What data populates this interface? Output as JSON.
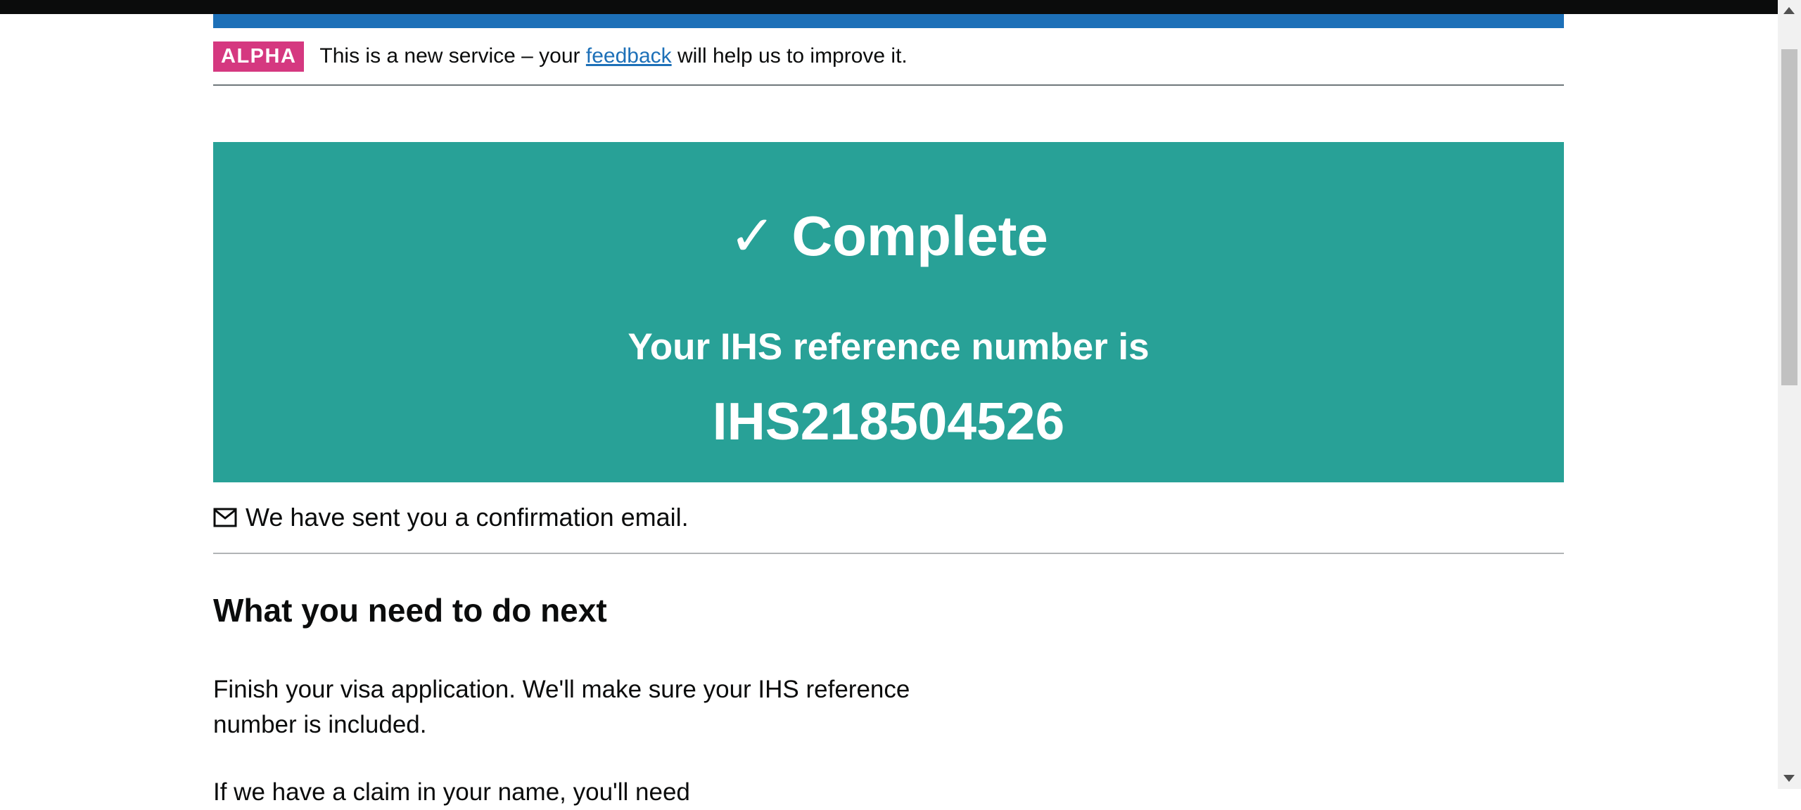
{
  "phase_banner": {
    "tag": "ALPHA",
    "text_before": "This is a new service – your ",
    "link_text": "feedback",
    "text_after": " will help us to improve it."
  },
  "confirmation_panel": {
    "title": "✓ Complete",
    "subtitle": "Your IHS reference number is",
    "reference": "IHS218504526"
  },
  "email_notice": {
    "icon": "mail-icon",
    "text": "We have sent you a confirmation email."
  },
  "next_steps": {
    "heading": "What you need to do next",
    "paragraph_1": "Finish your visa application. We'll make sure your IHS reference number is included.",
    "paragraph_2": "If we have a claim in your name, you'll need"
  },
  "colors": {
    "panel": "#28a197",
    "tag": "#d53880",
    "link": "#1d70b8",
    "header_bar": "#1d70b8"
  }
}
